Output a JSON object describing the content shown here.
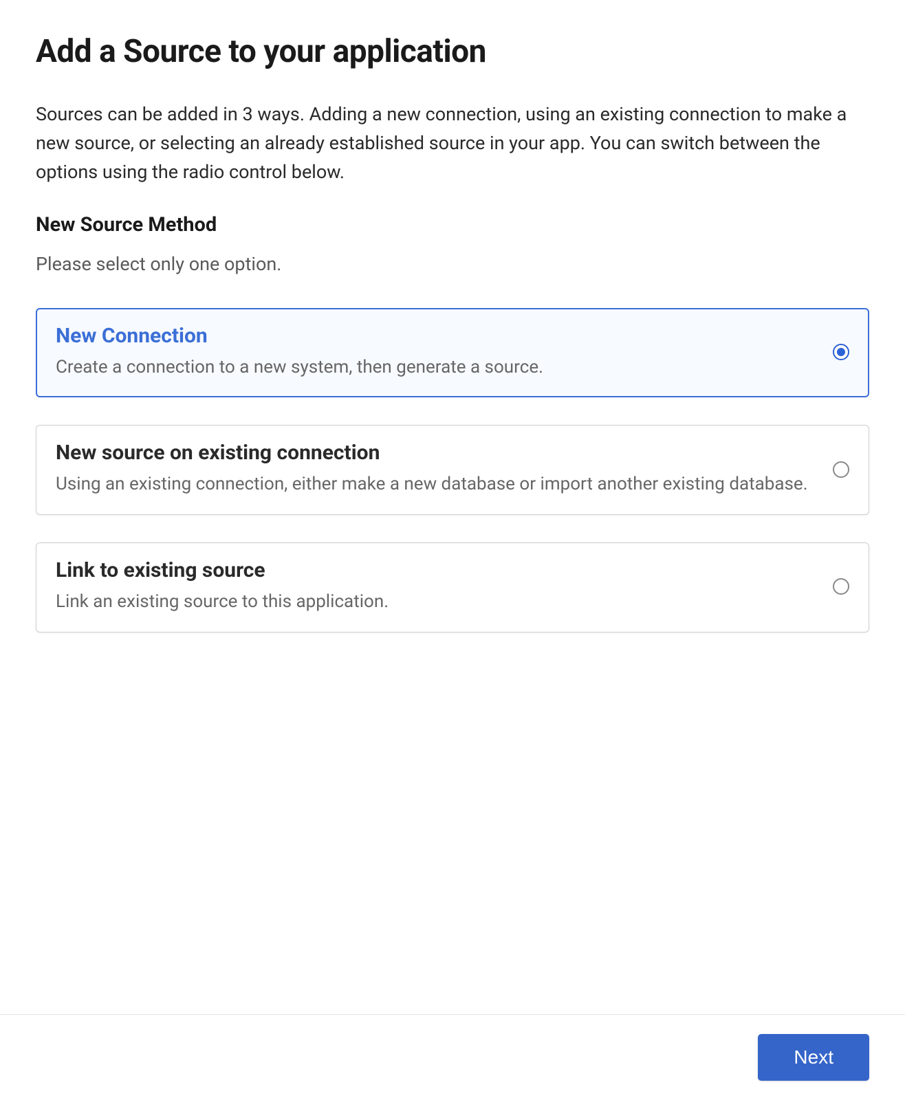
{
  "header": {
    "title": "Add a Source to your application"
  },
  "intro": "Sources can be added in 3 ways. Adding a new connection, using an existing connection to make a new source, or selecting an already established source in your app. You can switch between the options using the radio control below.",
  "section": {
    "heading": "New Source Method",
    "hint": "Please select only one option."
  },
  "options": [
    {
      "title": "New Connection",
      "desc": "Create a connection to a new system, then generate a source.",
      "selected": true
    },
    {
      "title": "New source on existing connection",
      "desc": "Using an existing connection, either make a new database or import another existing database.",
      "selected": false
    },
    {
      "title": "Link to existing source",
      "desc": "Link an existing source to this application.",
      "selected": false
    }
  ],
  "footer": {
    "next_label": "Next"
  }
}
